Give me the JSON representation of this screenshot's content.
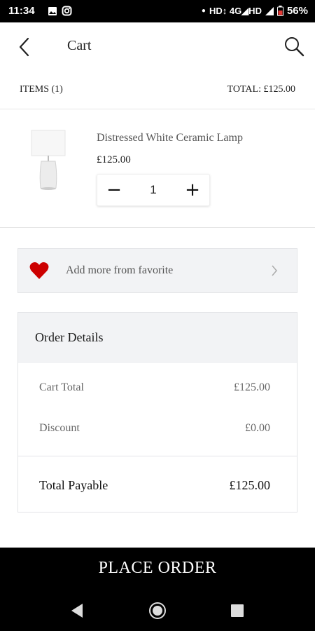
{
  "status_bar": {
    "time": "11:34",
    "network": "HD↕ 4G◢HD",
    "battery": "56%"
  },
  "app_bar": {
    "title": "Cart"
  },
  "summary": {
    "items": "ITEMS (1)",
    "total": "TOTAL: £125.00"
  },
  "cart_item": {
    "name": "Distressed White Ceramic Lamp",
    "price": "£125.00",
    "quantity": "1",
    "minus": "−",
    "plus": "+"
  },
  "favorite": {
    "label": "Add more from favorite"
  },
  "order_details": {
    "title": "Order Details",
    "cart_total_label": "Cart Total",
    "cart_total_value": "£125.00",
    "discount_label": "Discount",
    "discount_value": "£0.00",
    "payable_label": "Total Payable",
    "payable_value": "£125.00"
  },
  "place_order": "PLACE ORDER",
  "colors": {
    "heart": "#cc0000",
    "panel": "#f2f3f5",
    "primary": "#000000"
  }
}
